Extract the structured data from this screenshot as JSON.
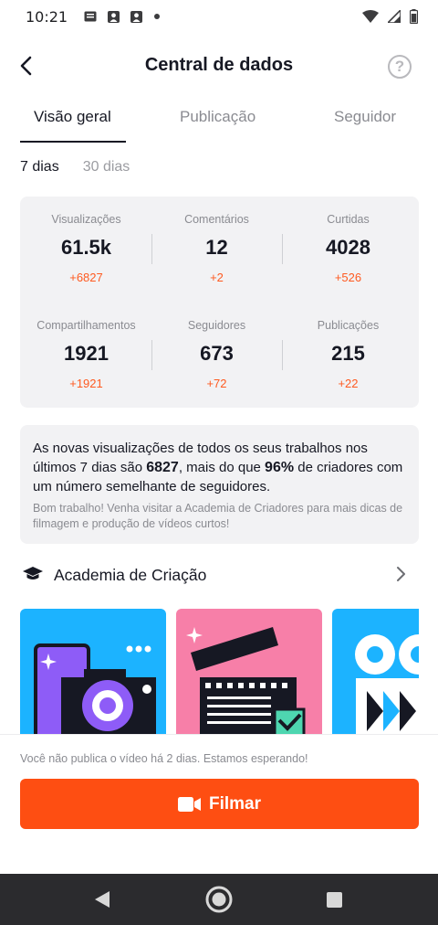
{
  "status_bar": {
    "time": "10:21",
    "left_icons": [
      "message-icon",
      "user-icon",
      "user-icon",
      "dot-icon"
    ],
    "right_icons": [
      "wifi-icon",
      "signal-icon",
      "battery-icon"
    ]
  },
  "header": {
    "title": "Central de dados",
    "back_icon": "back-arrow-icon",
    "help_label": "?"
  },
  "tabs": [
    {
      "label": "Visão geral",
      "active": true
    },
    {
      "label": "Publicação",
      "active": false
    },
    {
      "label": "Seguidor",
      "active": false
    }
  ],
  "range": {
    "options": [
      {
        "label": "7 dias",
        "active": true
      },
      {
        "label": "30 dias",
        "active": false
      }
    ]
  },
  "stats": [
    {
      "label": "Visualizações",
      "value": "61.5k",
      "delta": "+6827"
    },
    {
      "label": "Comentários",
      "value": "12",
      "delta": "+2"
    },
    {
      "label": "Curtidas",
      "value": "4028",
      "delta": "+526"
    },
    {
      "label": "Compartilhamentos",
      "value": "1921",
      "delta": "+1921"
    },
    {
      "label": "Seguidores",
      "value": "673",
      "delta": "+72"
    },
    {
      "label": "Publicações",
      "value": "215",
      "delta": "+22"
    }
  ],
  "insight": {
    "part1": "As novas visualizações de todos os seus trabalhos nos últimos 7 dias são ",
    "views": "6827",
    "part2": ", mais do que ",
    "percent": "96%",
    "part3": " de criadores com um número semelhante de seguidores.",
    "sub": "Bom trabalho! Venha visitar a Academia de Criadores para mais dicas de filmagem e produção de vídeos curtos!"
  },
  "academy": {
    "title": "Academia de Criação",
    "icon": "graduation-cap-icon"
  },
  "bottom": {
    "nudge": "Você não publica o vídeo há 2 dias. Estamos esperando!",
    "film_label": "Filmar",
    "film_icon": "video-camera-icon"
  },
  "colors": {
    "accent": "#fe4e12",
    "delta": "#fe5a20",
    "card_blue": "#1cb3ff",
    "card_pink": "#f77fa8"
  }
}
